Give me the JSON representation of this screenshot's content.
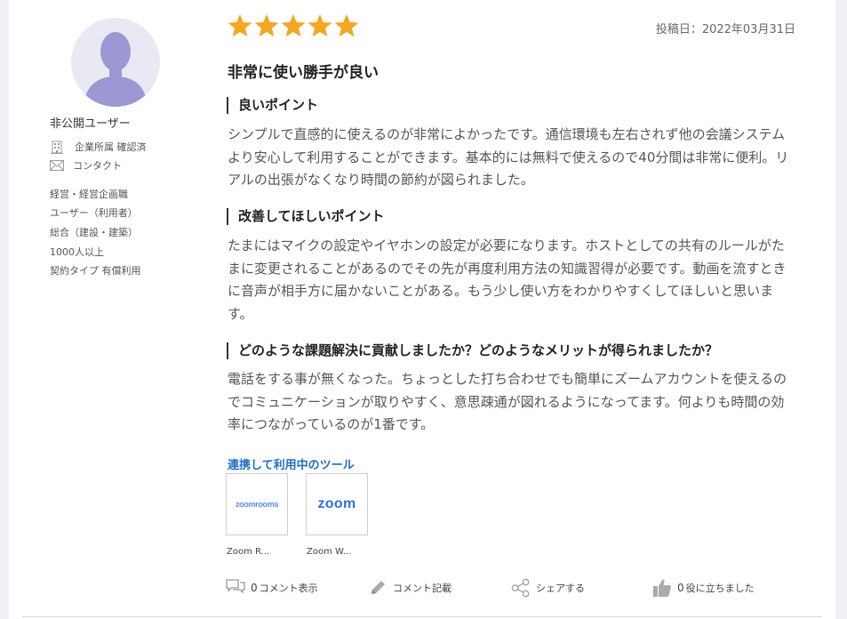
{
  "reviewer": {
    "name": "非公開ユーザー",
    "company_verified": "企業所属 確認済",
    "contact": "コンタクト",
    "profile": [
      "経営・経営企画職",
      "ユーザー（利用者）",
      "総合（建設・建築）",
      "1000人以上",
      "契約タイプ 有償利用"
    ]
  },
  "review": {
    "rating": 5,
    "post_date": "投稿日：2022年03月31日",
    "title": "非常に使い勝手が良い",
    "sections": [
      {
        "heading": "良いポイント",
        "body": "シンプルで直感的に使えるのが非常によかったです。通信環境も左右されず他の会議システムより安心して利用することができます。基本的には無料で使えるので40分間は非常に便利。リアルの出張がなくなり時間の節約が図られました。"
      },
      {
        "heading": "改善してほしいポイント",
        "body": "たまにはマイクの設定やイヤホンの設定が必要になります。ホストとしての共有のルールがたまに変更されることがあるのでその先が再度利用方法の知識習得が必要です。動画を流すときに音声が相手方に届かないことがある。もう少し使い方をわかりやすくしてほしいと思います。"
      },
      {
        "heading": "どのような課題解決に貢献しましたか？どのようなメリットが得られましたか？",
        "body": "電話をする事が無くなった。ちょっとした打ち合わせでも簡単にズームアカウントを使えるのでコミュニケーションが取りやすく、意思疎通が図れるようになってます。何よりも時間の効率につながっているのが1番です。"
      }
    ]
  },
  "tools": {
    "title": "連携して利用中のツール",
    "items": [
      {
        "label": "Zoom R...",
        "logo_text": "zoomrooms"
      },
      {
        "label": "Zoom W...",
        "logo_text": "zoom"
      }
    ]
  },
  "actions": {
    "comment_count": "0",
    "comment_show": "コメント表示",
    "comment_write": "コメント記載",
    "share": "シェアする",
    "helpful_count": "0",
    "helpful": "役に立ちました"
  },
  "colors": {
    "star": "#f5a623",
    "link": "#1a6fc4",
    "avatar_fg": "#9b98d3",
    "avatar_bg": "#e9e9f4"
  }
}
